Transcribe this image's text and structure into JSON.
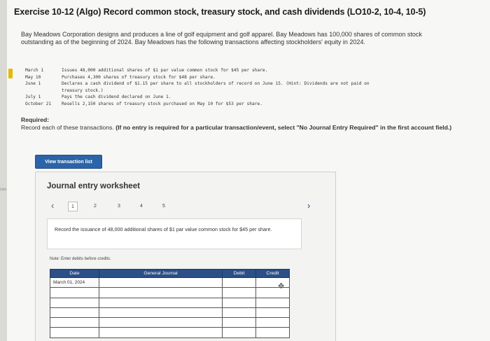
{
  "side_label": "ces",
  "title": "Exercise 10-12 (Algo) Record common stock, treasury stock, and cash dividends (LO10-2, 10-4, 10-5)",
  "intro": "Bay Meadows Corporation designs and produces a line of golf equipment and golf apparel. Bay Meadows has 100,000 shares of common stock outstanding as of the beginning of 2024. Bay Meadows has the following transactions affecting stockholders' equity in 2024.",
  "transactions": [
    {
      "date": "March 1",
      "desc": "Issues 48,000 additional shares of $1 par value common stock for $45 per share."
    },
    {
      "date": "May 10",
      "desc": "Purchases 4,300 shares of treasury stock for $48 per share."
    },
    {
      "date": "June 1",
      "desc": "Declares a cash dividend of $1.15 per share to all stockholders of record on June 15. (Hint: Dividends are not paid on",
      "cont": "treasury stock.)"
    },
    {
      "date": "July 1",
      "desc": "Pays the cash dividend declared on June 1."
    },
    {
      "date": "October 21",
      "desc": "Resells 2,150 shares of treasury stock purchased on May 10 for $53 per share."
    }
  ],
  "required": {
    "heading": "Required:",
    "text": "Record each of these transactions.",
    "bold_text": "(If no entry is required for a particular transaction/event, select \"No Journal Entry Required\" in the first account field.)"
  },
  "view_button": "View transaction list",
  "worksheet": {
    "title": "Journal entry worksheet",
    "pages": [
      "1",
      "2",
      "3",
      "4",
      "5"
    ],
    "active_page": 1,
    "prev_symbol": "‹",
    "next_symbol": "›",
    "instruction": "Record the issuance of 48,000 additional shares of $1 par value common stock for $45 per share.",
    "note": "Note: Enter debits before credits.",
    "columns": [
      "Date",
      "General Journal",
      "Debit",
      "Credit"
    ],
    "rows": [
      {
        "date": "March 01, 2024",
        "account": "",
        "debit": "",
        "credit": ""
      },
      {
        "date": "",
        "account": "",
        "debit": "",
        "credit": ""
      },
      {
        "date": "",
        "account": "",
        "debit": "",
        "credit": ""
      },
      {
        "date": "",
        "account": "",
        "debit": "",
        "credit": ""
      },
      {
        "date": "",
        "account": "",
        "debit": "",
        "credit": ""
      },
      {
        "date": "",
        "account": "",
        "debit": "",
        "credit": ""
      }
    ]
  }
}
